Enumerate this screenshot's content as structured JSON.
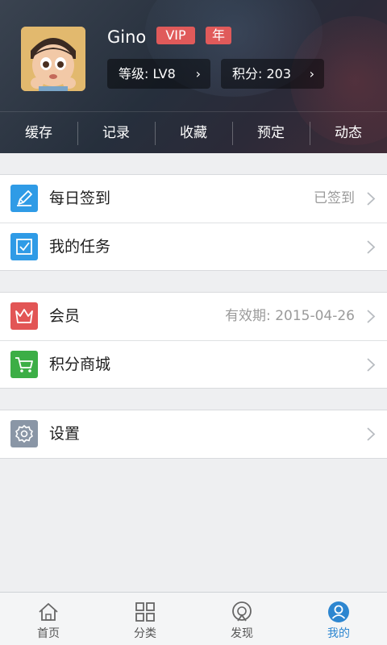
{
  "profile": {
    "username": "Gino",
    "badge_vip": "VIP",
    "badge_year": "年",
    "level": "等级: LV8",
    "points": "积分: 203",
    "chevron": "›"
  },
  "tabs": [
    "缓存",
    "记录",
    "收藏",
    "预定",
    "动态"
  ],
  "groups": {
    "g1": [
      {
        "label": "每日签到",
        "value": "已签到",
        "icon": "pen-icon",
        "color": "#2f9be6"
      },
      {
        "label": "我的任务",
        "value": "",
        "icon": "checkbox-icon",
        "color": "#2f9be6"
      }
    ],
    "g2": [
      {
        "label": "会员",
        "value": "有效期: 2015-04-26",
        "icon": "crown-icon",
        "color": "#e25555"
      },
      {
        "label": "积分商城",
        "value": "",
        "icon": "cart-icon",
        "color": "#3cae46"
      }
    ],
    "g3": [
      {
        "label": "设置",
        "value": "",
        "icon": "gear-icon",
        "color": "#8a96a6"
      }
    ]
  },
  "bottom_nav": [
    {
      "label": "首页",
      "icon": "home-icon",
      "active": false
    },
    {
      "label": "分类",
      "icon": "grid-icon",
      "active": false
    },
    {
      "label": "发现",
      "icon": "discover-icon",
      "active": false
    },
    {
      "label": "我的",
      "icon": "profile-icon",
      "active": true
    }
  ],
  "colors": {
    "accent": "#2d86d0",
    "badge": "#e05a5a"
  }
}
